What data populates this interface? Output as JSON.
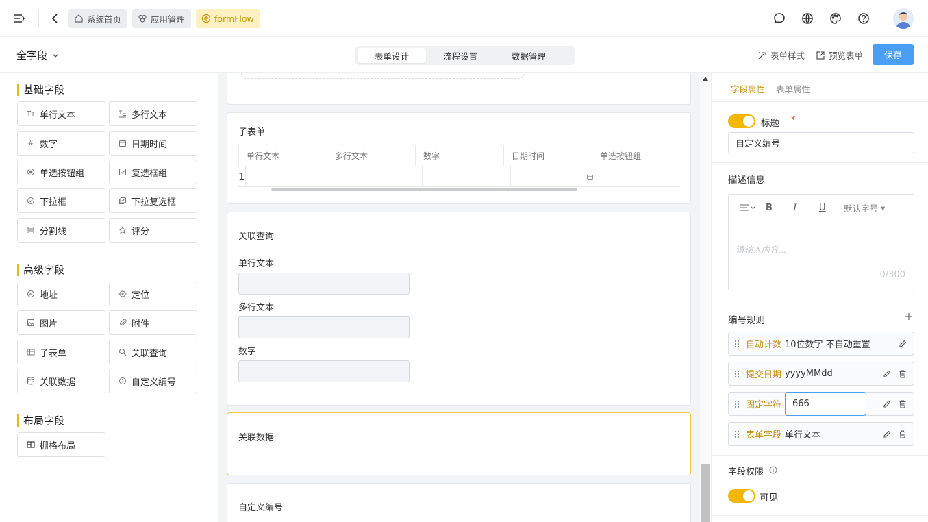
{
  "breadcrumbs": [
    {
      "label": "系统首页",
      "icon": "home-icon"
    },
    {
      "label": "应用管理",
      "icon": "apps-icon"
    },
    {
      "label": "formFlow",
      "icon": "flow-icon"
    }
  ],
  "topIcons": [
    "message-icon",
    "globe-icon",
    "palette-icon",
    "help-icon"
  ],
  "subbar": {
    "scope": "全字段",
    "tabs": [
      "表单设计",
      "流程设置",
      "数据管理"
    ],
    "activeTab": "表单设计",
    "styleLabel": "表单样式",
    "previewLabel": "预览表单",
    "saveLabel": "保存"
  },
  "palette": {
    "basic": {
      "title": "基础字段",
      "items": [
        "单行文本",
        "多行文本",
        "数字",
        "日期时间",
        "单选按钮组",
        "复选框组",
        "下拉框",
        "下拉复选框",
        "分割线",
        "评分"
      ]
    },
    "advanced": {
      "title": "高级字段",
      "items": [
        "地址",
        "定位",
        "图片",
        "附件",
        "子表单",
        "关联查询",
        "关联数据",
        "自定义编号"
      ]
    },
    "layout": {
      "title": "布局字段",
      "items": [
        "栅格布局"
      ]
    }
  },
  "canvas": {
    "subform": {
      "title": "子表单",
      "columns": [
        "单行文本",
        "多行文本",
        "数字",
        "日期时间",
        "单选按钮组"
      ],
      "rowIndex": "1"
    },
    "lookup": {
      "title": "关联查询",
      "fields": [
        "单行文本",
        "多行文本",
        "数字"
      ]
    },
    "relatedData": {
      "title": "关联数据"
    },
    "customNumber": {
      "title": "自定义编号"
    }
  },
  "panel": {
    "tabs": [
      "字段属性",
      "表单属性"
    ],
    "activeTab": "字段属性",
    "titleLabel": "标题",
    "required": "*",
    "titleValue": "自定义编号",
    "descLabel": "描述信息",
    "editor": {
      "fontSize": "默认字号",
      "placeholder": "请输入内容...",
      "counter": "0/300"
    },
    "rulesLabel": "编号规则",
    "rules": [
      {
        "name": "自动计数",
        "value": "10位数字 不自动重置"
      },
      {
        "name": "提交日期",
        "value": "yyyyMMdd"
      },
      {
        "name": "固定字符",
        "value": "666"
      },
      {
        "name": "表单字段",
        "value": "单行文本"
      }
    ],
    "permLabel": "字段权限",
    "visibleLabel": "可见",
    "titleToggle": true,
    "visibleToggle": true
  }
}
